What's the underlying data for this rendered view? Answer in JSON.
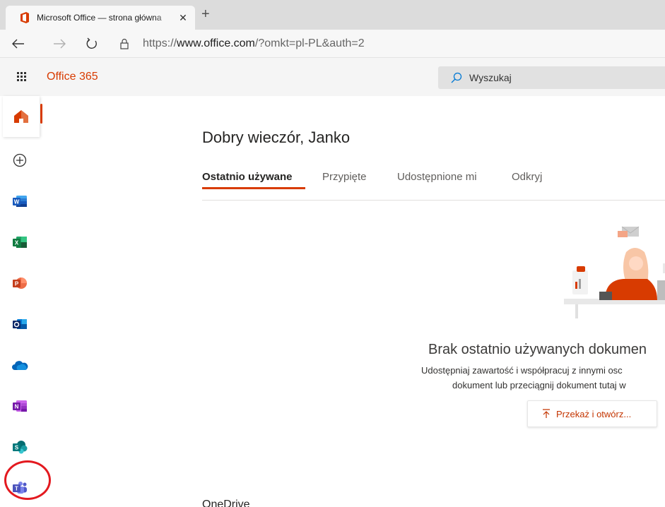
{
  "browser": {
    "tab_title": "Microsoft Office — strona główna",
    "tab_close": "✕",
    "new_tab": "+",
    "url_scheme": "https://",
    "url_host": "www.office.com",
    "url_path": "/?omkt=pl-PL&auth=2"
  },
  "header": {
    "brand": "Office 365",
    "search_placeholder": "Wyszukaj"
  },
  "rail": {
    "items": [
      "home-icon",
      "create-icon",
      "word-icon",
      "excel-icon",
      "powerpoint-icon",
      "outlook-icon",
      "onedrive-icon",
      "onenote-icon",
      "sharepoint-icon",
      "teams-icon"
    ]
  },
  "main": {
    "greeting": "Dobry wieczór, Janko",
    "tabs": [
      {
        "label": "Ostatnio używane"
      },
      {
        "label": "Przypięte"
      },
      {
        "label": "Udostępnione mi"
      },
      {
        "label": "Odkryj"
      }
    ],
    "empty_title": "Brak ostatnio używanych dokumen",
    "empty_line1": "Udostępniaj zawartość i współpracuj z innymi osc",
    "empty_line2": "dokument lub przeciągnij dokument tutaj w",
    "upload_label": "Przekaż i otwórz...",
    "section_heading": "OneDrive"
  },
  "colors": {
    "accent": "#d83b01",
    "annotation_circle": "#e3191f"
  }
}
